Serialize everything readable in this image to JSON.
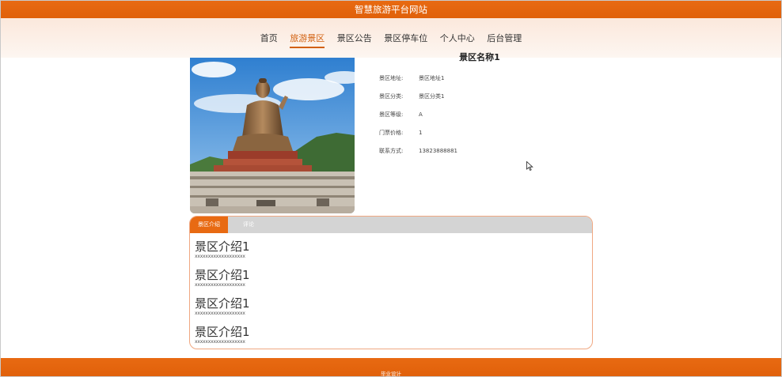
{
  "site": {
    "title": "智慧旅游平台网站"
  },
  "nav": {
    "items": [
      "首页",
      "旅游景区",
      "景区公告",
      "景区停车位",
      "个人中心",
      "后台管理"
    ],
    "active_index": 1
  },
  "detail": {
    "name": "景区名称1",
    "fields": [
      {
        "label": "景区地址:",
        "value": "景区地址1"
      },
      {
        "label": "景区分类:",
        "value": "景区分类1"
      },
      {
        "label": "景区等级:",
        "value": "A"
      },
      {
        "label": "门票价格:",
        "value": "1"
      },
      {
        "label": "联系方式:",
        "value": "13823888881"
      }
    ]
  },
  "tabs": {
    "intro": "景区介绍",
    "comments": "评论"
  },
  "intro": [
    {
      "heading": "景区介绍1",
      "text": "xxxxxxxxxxxxxxxxxxx"
    },
    {
      "heading": "景区介绍1",
      "text": "xxxxxxxxxxxxxxxxxxx"
    },
    {
      "heading": "景区介绍1",
      "text": "xxxxxxxxxxxxxxxxxxx"
    },
    {
      "heading": "景区介绍1",
      "text": "xxxxxxxxxxxxxxxxxxx"
    }
  ],
  "footer": {
    "text": "毕业设计"
  },
  "colors": {
    "accent": "#e86a12",
    "nav_bg": "#fbe8dc",
    "panel_border": "#f0a882",
    "tab_bar": "#d4d4d4"
  }
}
